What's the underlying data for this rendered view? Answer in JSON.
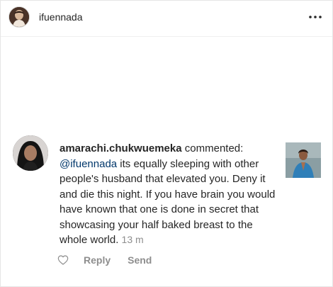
{
  "header": {
    "username": "ifuennada",
    "avatar_icon": "profile-photo",
    "more_icon": "more-horizontal-icon"
  },
  "comment": {
    "username": "amarachi.chukwuemeka",
    "verb": "commented:",
    "mention": "@ifuennada",
    "text": "its equally sleeping with other people's husband that elevated you. Deny it and die this night. If you have brain you would have known that one is done in secret that showcasing your half baked breast to the whole world.",
    "timestamp": "13 m"
  },
  "actions": {
    "like_icon": "heart-outline-icon",
    "reply_label": "Reply",
    "send_label": "Send"
  },
  "colors": {
    "text": "#262626",
    "mention": "#00376b",
    "muted": "#8e8e8e",
    "border": "#efefef"
  }
}
